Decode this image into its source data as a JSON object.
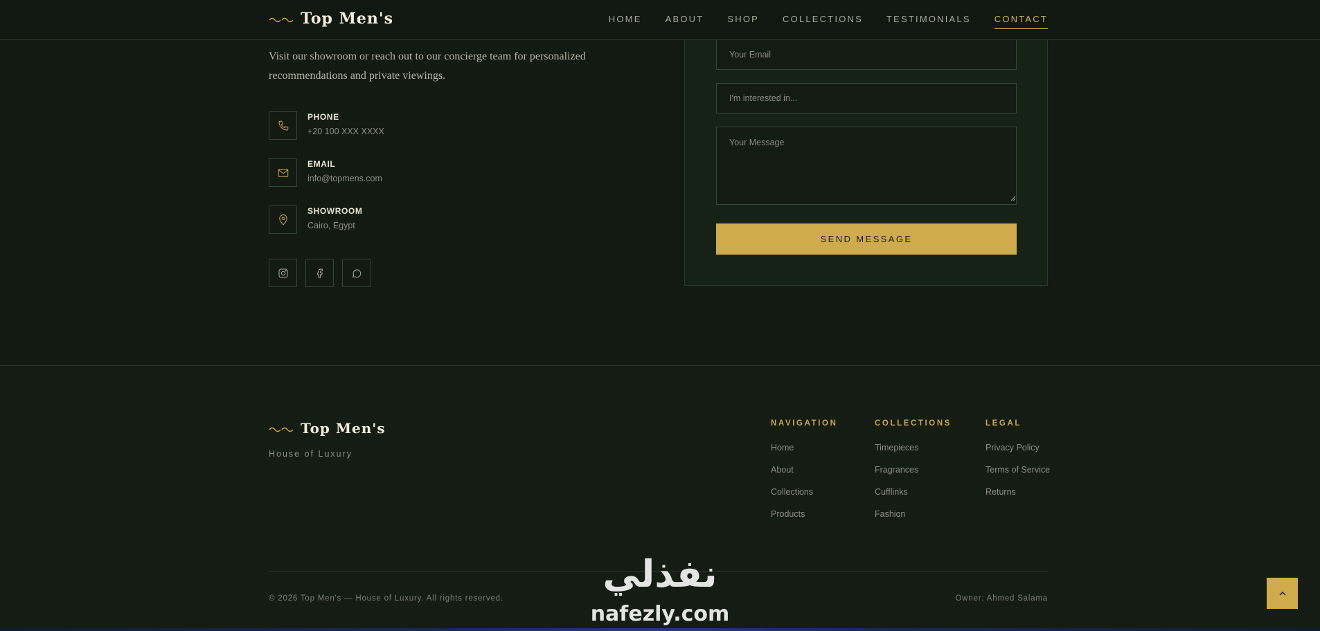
{
  "brand": {
    "name": "Top Men's",
    "tagline": "House of Luxury",
    "accent": "#cfab4c"
  },
  "nav": {
    "items": [
      {
        "label": "HOME",
        "active": false
      },
      {
        "label": "ABOUT",
        "active": false
      },
      {
        "label": "SHOP",
        "active": false
      },
      {
        "label": "COLLECTIONS",
        "active": false
      },
      {
        "label": "TESTIMONIALS",
        "active": false
      },
      {
        "label": "CONTACT",
        "active": true
      }
    ]
  },
  "contact": {
    "intro": "Visit our showroom or reach out to our concierge team for personalized recommendations and private viewings.",
    "items": [
      {
        "label": "PHONE",
        "value": "+20 100 XXX XXXX",
        "icon": "phone-icon"
      },
      {
        "label": "EMAIL",
        "value": "info@topmens.com",
        "icon": "mail-icon"
      },
      {
        "label": "SHOWROOM",
        "value": "Cairo, Egypt",
        "icon": "map-pin-icon"
      }
    ],
    "socials": [
      "instagram-icon",
      "facebook-icon",
      "chat-icon"
    ]
  },
  "form": {
    "email_placeholder": "Your Email",
    "interest_placeholder": "I'm interested in...",
    "message_placeholder": "Your Message",
    "submit_label": "SEND MESSAGE"
  },
  "footer": {
    "columns": [
      {
        "title": "NAVIGATION",
        "links": [
          "Home",
          "About",
          "Collections",
          "Products"
        ]
      },
      {
        "title": "COLLECTIONS",
        "links": [
          "Timepieces",
          "Fragrances",
          "Cufflinks",
          "Fashion"
        ]
      },
      {
        "title": "LEGAL",
        "links": [
          "Privacy Policy",
          "Terms of Service",
          "Returns"
        ]
      }
    ],
    "copyright": "© 2026 Top Men's — House of Luxury. All rights reserved.",
    "owner": "Owner: Ahmed Salama"
  },
  "watermark": {
    "arabic": "نفذلي",
    "latin": "nafezly.com"
  }
}
